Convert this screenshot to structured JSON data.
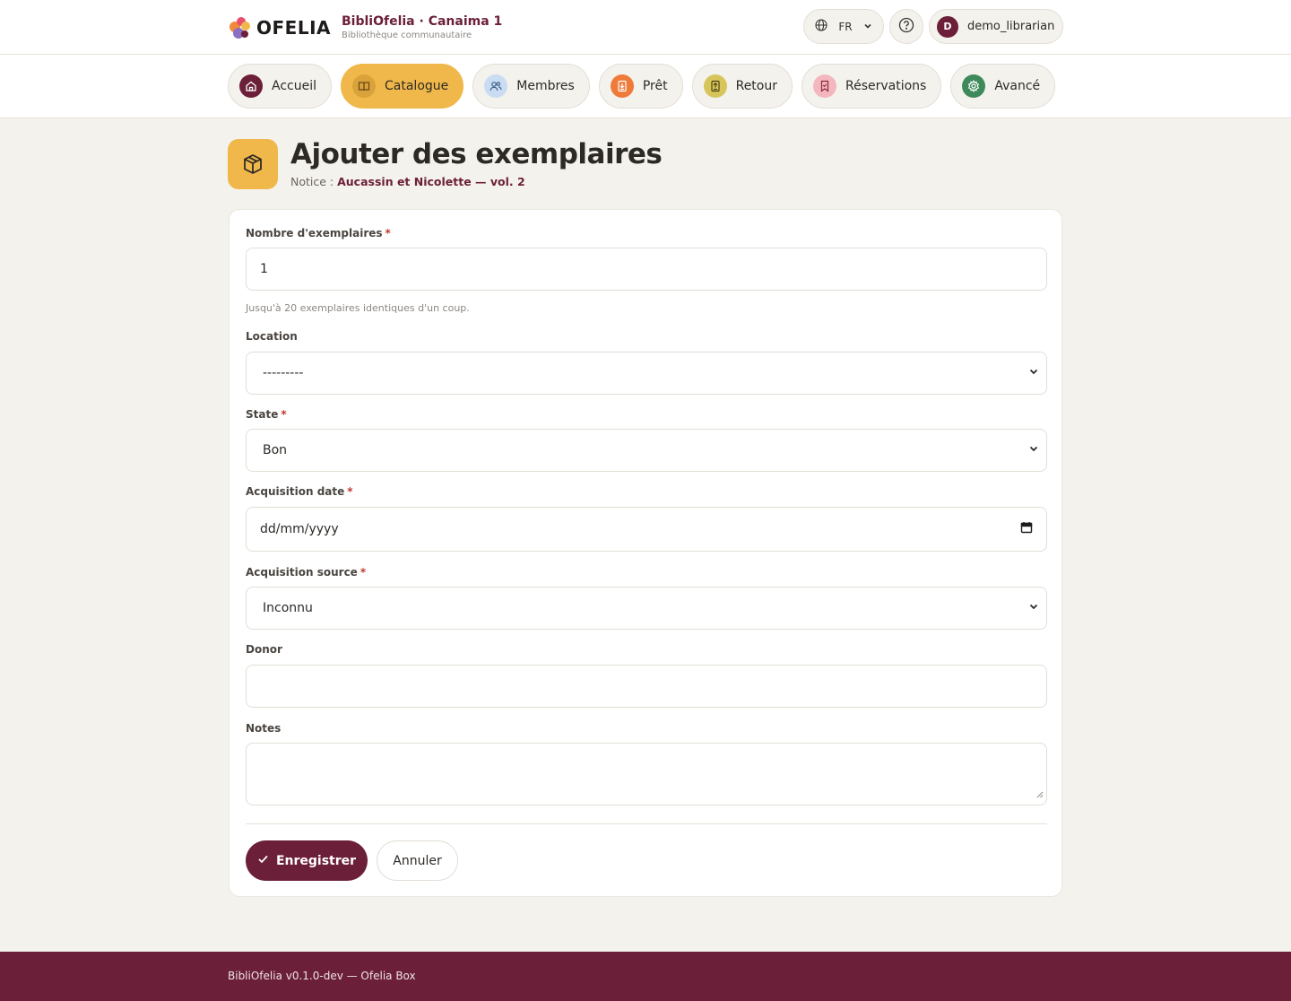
{
  "header": {
    "logo_text": "OFELIA",
    "brand_title": "BibliOfelia · Canaima 1",
    "brand_subtitle": "Bibliothèque communautaire",
    "language": "FR",
    "user_initial": "D",
    "username": "demo_librarian"
  },
  "nav": {
    "items": [
      {
        "label": "Accueil",
        "icon": "home-icon"
      },
      {
        "label": "Catalogue",
        "icon": "book-open-icon"
      },
      {
        "label": "Membres",
        "icon": "users-icon"
      },
      {
        "label": "Prêt",
        "icon": "checkout-icon"
      },
      {
        "label": "Retour",
        "icon": "return-icon"
      },
      {
        "label": "Réservations",
        "icon": "bookmark-icon"
      },
      {
        "label": "Avancé",
        "icon": "gear-icon"
      }
    ],
    "active": "Catalogue"
  },
  "page": {
    "title": "Ajouter des exemplaires",
    "notice_prefix": "Notice :",
    "notice_link": "Aucassin et Nicolette — vol. 2",
    "icon": "package-icon"
  },
  "form": {
    "count_label": "Nombre d'exemplaires",
    "count_value": "1",
    "count_help": "Jusqu'à 20 exemplaires identiques d'un coup.",
    "location_label": "Location",
    "location_value": "---------",
    "state_label": "State",
    "state_value": "Bon",
    "acq_date_label": "Acquisition date",
    "acq_date_placeholder": "dd/mm/yyyy",
    "acq_source_label": "Acquisition source",
    "acq_source_value": "Inconnu",
    "donor_label": "Donor",
    "donor_value": "",
    "notes_label": "Notes",
    "notes_value": "",
    "required_mark": "*",
    "save_label": "Enregistrer",
    "cancel_label": "Annuler"
  },
  "footer": {
    "text": "BibliOfelia v0.1.0-dev — Ofelia Box"
  },
  "colors": {
    "brand": "#6b1f38",
    "accent": "#f0b84a",
    "background": "#f4f2ec"
  }
}
